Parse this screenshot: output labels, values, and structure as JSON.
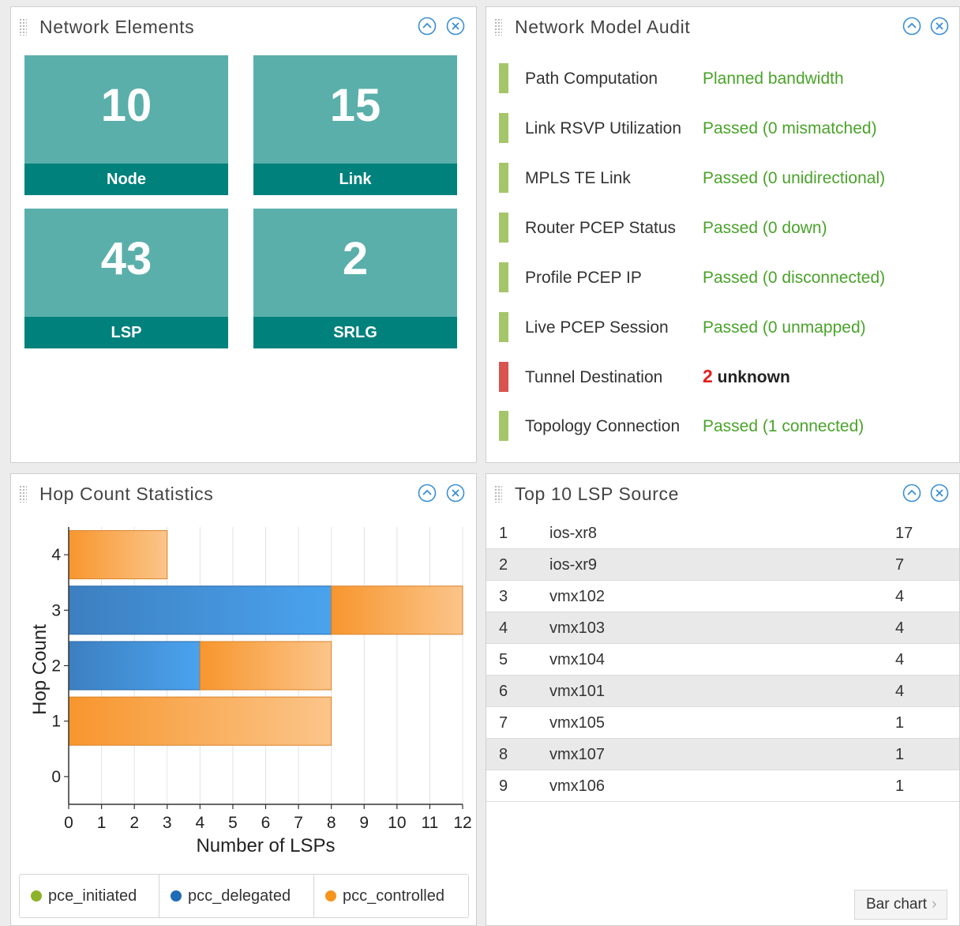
{
  "network_elements": {
    "title": "Network Elements",
    "tiles": [
      {
        "value": "10",
        "label": "Node"
      },
      {
        "value": "15",
        "label": "Link"
      },
      {
        "value": "43",
        "label": "LSP"
      },
      {
        "value": "2",
        "label": "SRLG"
      }
    ]
  },
  "audit": {
    "title": "Network Model Audit",
    "rows": [
      {
        "name": "Path Computation",
        "status": "Planned bandwidth",
        "state": "ok"
      },
      {
        "name": "Link RSVP Utilization",
        "status": "Passed (0 mismatched)",
        "state": "ok"
      },
      {
        "name": "MPLS TE Link",
        "status": "Passed (0 unidirectional)",
        "state": "ok"
      },
      {
        "name": "Router PCEP Status",
        "status": "Passed (0 down)",
        "state": "ok"
      },
      {
        "name": "Profile PCEP IP",
        "status": "Passed (0 disconnected)",
        "state": "ok"
      },
      {
        "name": "Live PCEP Session",
        "status": "Passed (0 unmapped)",
        "state": "ok"
      },
      {
        "name": "Tunnel Destination",
        "count": "2",
        "status": "unknown",
        "state": "fail"
      },
      {
        "name": "Topology Connection",
        "status": "Passed (1 connected)",
        "state": "ok"
      }
    ]
  },
  "hop_stats": {
    "title": "Hop Count Statistics",
    "legend": [
      {
        "name": "pce_initiated",
        "color": "#8db32a"
      },
      {
        "name": "pcc_delegated",
        "color": "#1f6bb5"
      },
      {
        "name": "pcc_controlled",
        "color": "#f7941d"
      }
    ]
  },
  "chart_data": {
    "type": "bar",
    "orientation": "horizontal",
    "stacked": true,
    "categories": [
      "0",
      "1",
      "2",
      "3",
      "4"
    ],
    "series": [
      {
        "name": "pce_initiated",
        "values": [
          0,
          0,
          0,
          0,
          0
        ],
        "color": "#8db32a"
      },
      {
        "name": "pcc_delegated",
        "values": [
          0,
          0,
          4,
          8,
          0
        ],
        "color": "#3f8fd8"
      },
      {
        "name": "pcc_controlled",
        "values": [
          0,
          8,
          4,
          4,
          3
        ],
        "color": "#f7a24b"
      }
    ],
    "xlabel": "Number of LSPs",
    "ylabel": "Hop Count",
    "xlim": [
      0,
      12
    ],
    "xticks": [
      "0",
      "1",
      "2",
      "3",
      "4",
      "5",
      "6",
      "7",
      "8",
      "9",
      "10",
      "11",
      "12"
    ],
    "grid": true,
    "legend_position": "bottom"
  },
  "top_lsp": {
    "title": "Top 10 LSP Source",
    "rows": [
      {
        "rank": "1",
        "name": "ios-xr8",
        "count": "17"
      },
      {
        "rank": "2",
        "name": "ios-xr9",
        "count": "7"
      },
      {
        "rank": "3",
        "name": "vmx102",
        "count": "4"
      },
      {
        "rank": "4",
        "name": "vmx103",
        "count": "4"
      },
      {
        "rank": "5",
        "name": "vmx104",
        "count": "4"
      },
      {
        "rank": "6",
        "name": "vmx101",
        "count": "4"
      },
      {
        "rank": "7",
        "name": "vmx105",
        "count": "1"
      },
      {
        "rank": "8",
        "name": "vmx107",
        "count": "1"
      },
      {
        "rank": "9",
        "name": "vmx106",
        "count": "1"
      }
    ],
    "bar_chart_label": "Bar chart"
  },
  "icons": {
    "collapse": "collapse-up-icon",
    "close": "close-circle-icon",
    "grip": "drag-grip-icon"
  }
}
